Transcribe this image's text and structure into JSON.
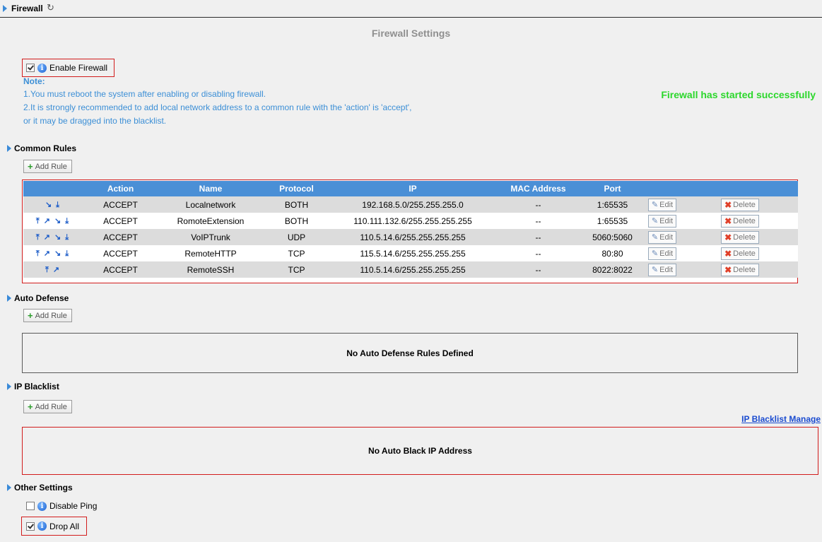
{
  "header": {
    "title": "Firewall",
    "refresh_icon": "refresh-icon"
  },
  "settings_title": "Firewall Settings",
  "enable_firewall": {
    "label": "Enable Firewall",
    "checked": true
  },
  "note": {
    "heading": "Note:",
    "line1": "1.You must reboot the system after enabling or disabling firewall.",
    "line2": "2.It is strongly recommended to add local network address to a common rule with the 'action' is 'accept',",
    "line3": "or it may be dragged into the blacklist."
  },
  "status_message": "Firewall has started successfully",
  "common_rules": {
    "title": "Common Rules",
    "add_label": "Add Rule",
    "columns": [
      "Action",
      "Name",
      "Protocol",
      "IP",
      "MAC Address",
      "Port"
    ],
    "edit_label": "Edit",
    "delete_label": "Delete",
    "rows": [
      {
        "arrows": "down-arrows",
        "action": "ACCEPT",
        "name": "Localnetwork",
        "protocol": "BOTH",
        "ip": "192.168.5.0/255.255.255.0",
        "mac": "--",
        "port": "1:65535"
      },
      {
        "arrows": "all-arrows",
        "action": "ACCEPT",
        "name": "RomoteExtension",
        "protocol": "BOTH",
        "ip": "110.111.132.6/255.255.255.255",
        "mac": "--",
        "port": "1:65535"
      },
      {
        "arrows": "all-arrows",
        "action": "ACCEPT",
        "name": "VoIPTrunk",
        "protocol": "UDP",
        "ip": "110.5.14.6/255.255.255.255",
        "mac": "--",
        "port": "5060:5060"
      },
      {
        "arrows": "all-arrows",
        "action": "ACCEPT",
        "name": "RemoteHTTP",
        "protocol": "TCP",
        "ip": "115.5.14.6/255.255.255.255",
        "mac": "--",
        "port": "80:80"
      },
      {
        "arrows": "up-arrows",
        "action": "ACCEPT",
        "name": "RemoteSSH",
        "protocol": "TCP",
        "ip": "110.5.14.6/255.255.255.255",
        "mac": "--",
        "port": "8022:8022"
      }
    ]
  },
  "auto_defense": {
    "title": "Auto Defense",
    "add_label": "Add Rule",
    "empty_text": "No Auto Defense Rules Defined"
  },
  "ip_blacklist": {
    "title": "IP Blacklist",
    "add_label": "Add Rule",
    "manage_link": "IP Blacklist Manage",
    "empty_text": "No Auto Black IP Address"
  },
  "other_settings": {
    "title": "Other Settings",
    "disable_ping": {
      "label": "Disable Ping",
      "checked": false
    },
    "drop_all": {
      "label": "Drop All",
      "checked": true
    }
  },
  "colors": {
    "accent": "#4a8fd6",
    "note": "#3c8fd6",
    "success": "#2cd72c",
    "highlight_border": "#d21c1c"
  }
}
